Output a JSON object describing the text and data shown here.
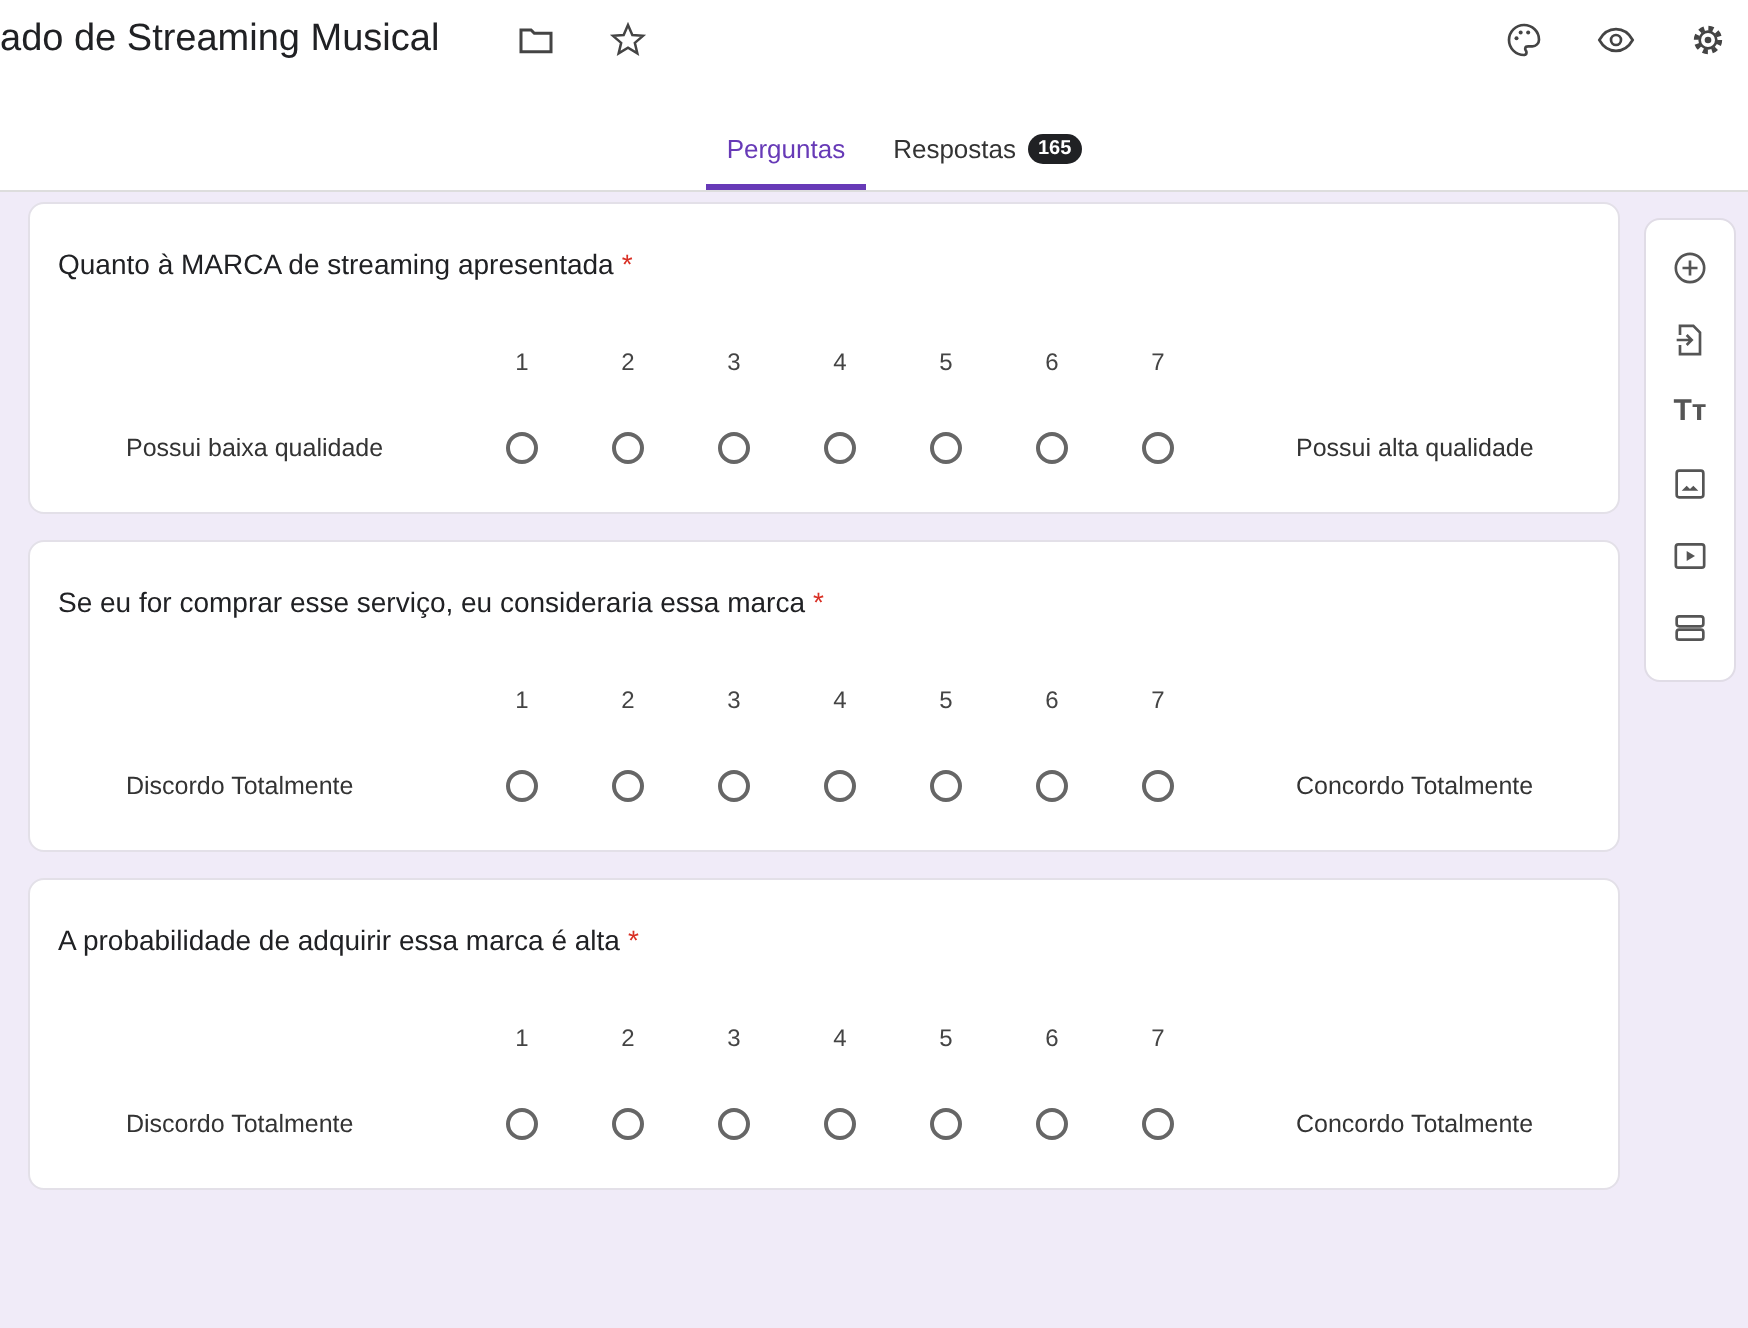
{
  "header": {
    "title": "ado de Streaming Musical"
  },
  "tabs": [
    {
      "label": "Perguntas",
      "selected": true
    },
    {
      "label": "Respostas",
      "badge": "165",
      "selected": false
    }
  ],
  "questions": [
    {
      "title": "Quanto à MARCA de streaming apresentada",
      "required_mark": "*",
      "scale": [
        {
          "label": "1",
          "selected": false
        },
        {
          "label": "2",
          "selected": false
        },
        {
          "label": "3",
          "selected": false
        },
        {
          "label": "4",
          "selected": false
        },
        {
          "label": "5",
          "selected": false
        },
        {
          "label": "6",
          "selected": false
        },
        {
          "label": "7",
          "selected": false
        }
      ],
      "low_label": "Possui baixa qualidade",
      "high_label": "Possui alta qualidade"
    },
    {
      "title": "Se eu for comprar esse serviço, eu consideraria essa marca",
      "required_mark": "*",
      "scale": [
        {
          "label": "1",
          "selected": false
        },
        {
          "label": "2",
          "selected": false
        },
        {
          "label": "3",
          "selected": false
        },
        {
          "label": "4",
          "selected": false
        },
        {
          "label": "5",
          "selected": false
        },
        {
          "label": "6",
          "selected": false
        },
        {
          "label": "7",
          "selected": false
        }
      ],
      "low_label": "Discordo Totalmente",
      "high_label": "Concordo Totalmente"
    },
    {
      "title": "A probabilidade de adquirir essa marca é alta",
      "required_mark": "*",
      "scale": [
        {
          "label": "1",
          "selected": false
        },
        {
          "label": "2",
          "selected": false
        },
        {
          "label": "3",
          "selected": false
        },
        {
          "label": "4",
          "selected": false
        },
        {
          "label": "5",
          "selected": false
        },
        {
          "label": "6",
          "selected": false
        },
        {
          "label": "7",
          "selected": false
        }
      ],
      "low_label": "Discordo Totalmente",
      "high_label": "Concordo Totalmente"
    }
  ],
  "toolbar": {
    "text_tool": "Tт"
  }
}
